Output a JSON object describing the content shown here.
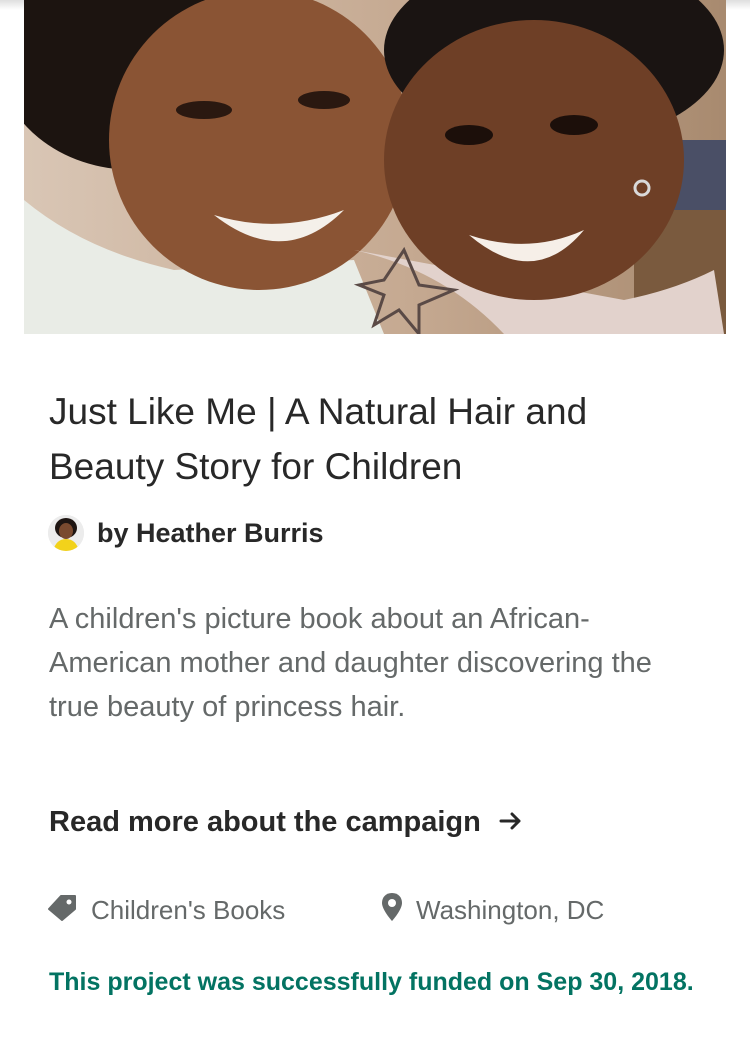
{
  "hero": {
    "image_icon": "mother-and-child-photo"
  },
  "project": {
    "title": "Just Like Me | A Natural Hair and Beauty Story for Children",
    "creator_label": "by Heather Burris",
    "blurb": "A children's picture book about an African-American mother and daughter discovering the true beauty of princess hair.",
    "read_more_label": "Read more about the campaign",
    "read_more_icon": "arrow-right-icon",
    "category": "Children's Books",
    "category_icon": "tag-icon",
    "location": "Washington, DC",
    "location_icon": "map-pin-icon",
    "funded_text": "This project was successfully funded on Sep 30, 2018."
  },
  "colors": {
    "title": "#282828",
    "secondary_text": "#656969",
    "funded_green": "#037362"
  }
}
